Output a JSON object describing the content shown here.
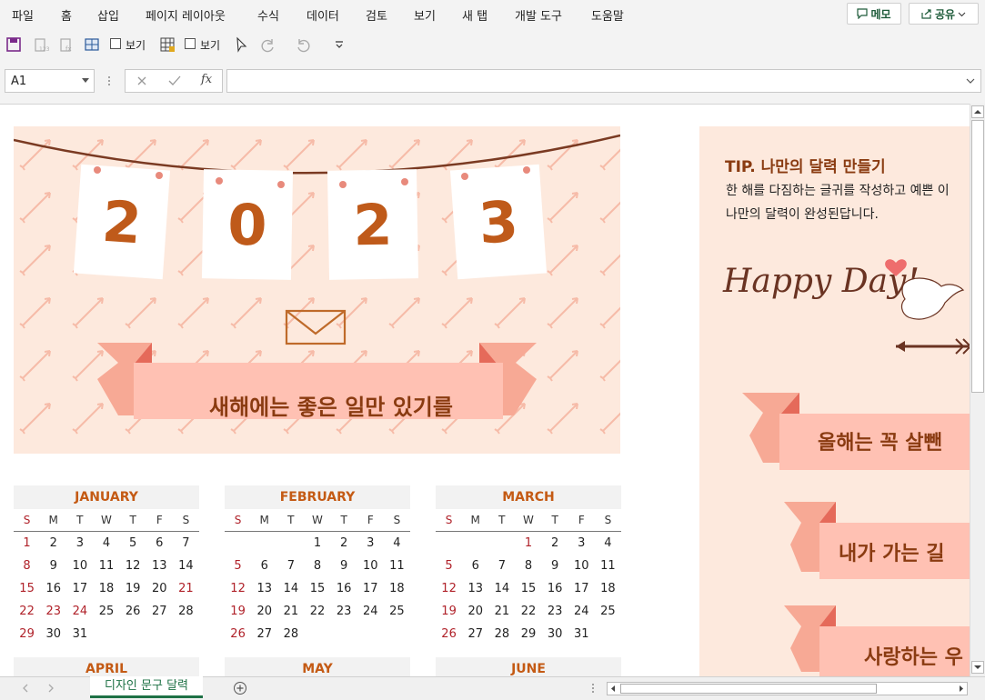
{
  "menu": [
    "파일",
    "홈",
    "삽입",
    "페이지 레이아웃",
    "수식",
    "데이터",
    "검토",
    "보기",
    "새 탭",
    "개발 도구",
    "도움말"
  ],
  "memo_label": "메모",
  "share_label": "공유",
  "qat": {
    "view_label_1": "보기",
    "view_label_2": "보기"
  },
  "formula_bar": {
    "name_box": "A1",
    "formula": ""
  },
  "banner": {
    "digits": [
      "2",
      "0",
      "2",
      "3"
    ],
    "ribbon_text": "새해에는 좋은 일만 있기를"
  },
  "colors": {
    "accent": "#c45a14",
    "banner_bg": "#fde9dd",
    "ribbon": "#ffc1b3",
    "sunday": "#b0222a",
    "tab_green": "#1e7145"
  },
  "weekday_headers": [
    "S",
    "M",
    "T",
    "W",
    "T",
    "F",
    "S"
  ],
  "months": [
    {
      "name": "JANUARY",
      "rows": [
        [
          "1",
          "2",
          "3",
          "4",
          "5",
          "6",
          "7"
        ],
        [
          "8",
          "9",
          "10",
          "11",
          "12",
          "13",
          "14"
        ],
        [
          "15",
          "16",
          "17",
          "18",
          "19",
          "20",
          "21"
        ],
        [
          "22",
          "23",
          "24",
          "25",
          "26",
          "27",
          "28"
        ],
        [
          "29",
          "30",
          "31",
          "",
          "",
          "",
          ""
        ]
      ]
    },
    {
      "name": "FEBRUARY",
      "rows": [
        [
          "",
          "",
          "",
          "1",
          "2",
          "3",
          "4"
        ],
        [
          "5",
          "6",
          "7",
          "8",
          "9",
          "10",
          "11"
        ],
        [
          "12",
          "13",
          "14",
          "15",
          "16",
          "17",
          "18"
        ],
        [
          "19",
          "20",
          "21",
          "22",
          "23",
          "24",
          "25"
        ],
        [
          "26",
          "27",
          "28",
          "",
          "",
          "",
          ""
        ]
      ]
    },
    {
      "name": "MARCH",
      "rows": [
        [
          "",
          "",
          "",
          "1",
          "2",
          "3",
          "4"
        ],
        [
          "5",
          "6",
          "7",
          "8",
          "9",
          "10",
          "11"
        ],
        [
          "12",
          "13",
          "14",
          "15",
          "16",
          "17",
          "18"
        ],
        [
          "19",
          "20",
          "21",
          "22",
          "23",
          "24",
          "25"
        ],
        [
          "26",
          "27",
          "28",
          "29",
          "30",
          "31",
          ""
        ]
      ]
    },
    {
      "name": "APRIL",
      "rows": []
    },
    {
      "name": "MAY",
      "rows": []
    },
    {
      "name": "JUNE",
      "rows": []
    }
  ],
  "holidays": {
    "JANUARY": [
      "1",
      "21",
      "22",
      "23",
      "24"
    ],
    "FEBRUARY": [],
    "MARCH": [
      "1"
    ]
  },
  "tip": {
    "label": "TIP.",
    "title": "나만의 달력 만들기",
    "line1": "한 해를 다짐하는 글귀를 작성하고 예쁜 이",
    "line2": "나만의 달력이 완성된답니다.",
    "script_text": "Happy Day!",
    "ribbons": [
      "올해는 꼭 살뺀",
      "내가 가는 길",
      "사랑하는 우"
    ]
  },
  "sheet_tab": "디자인 문구 달력"
}
